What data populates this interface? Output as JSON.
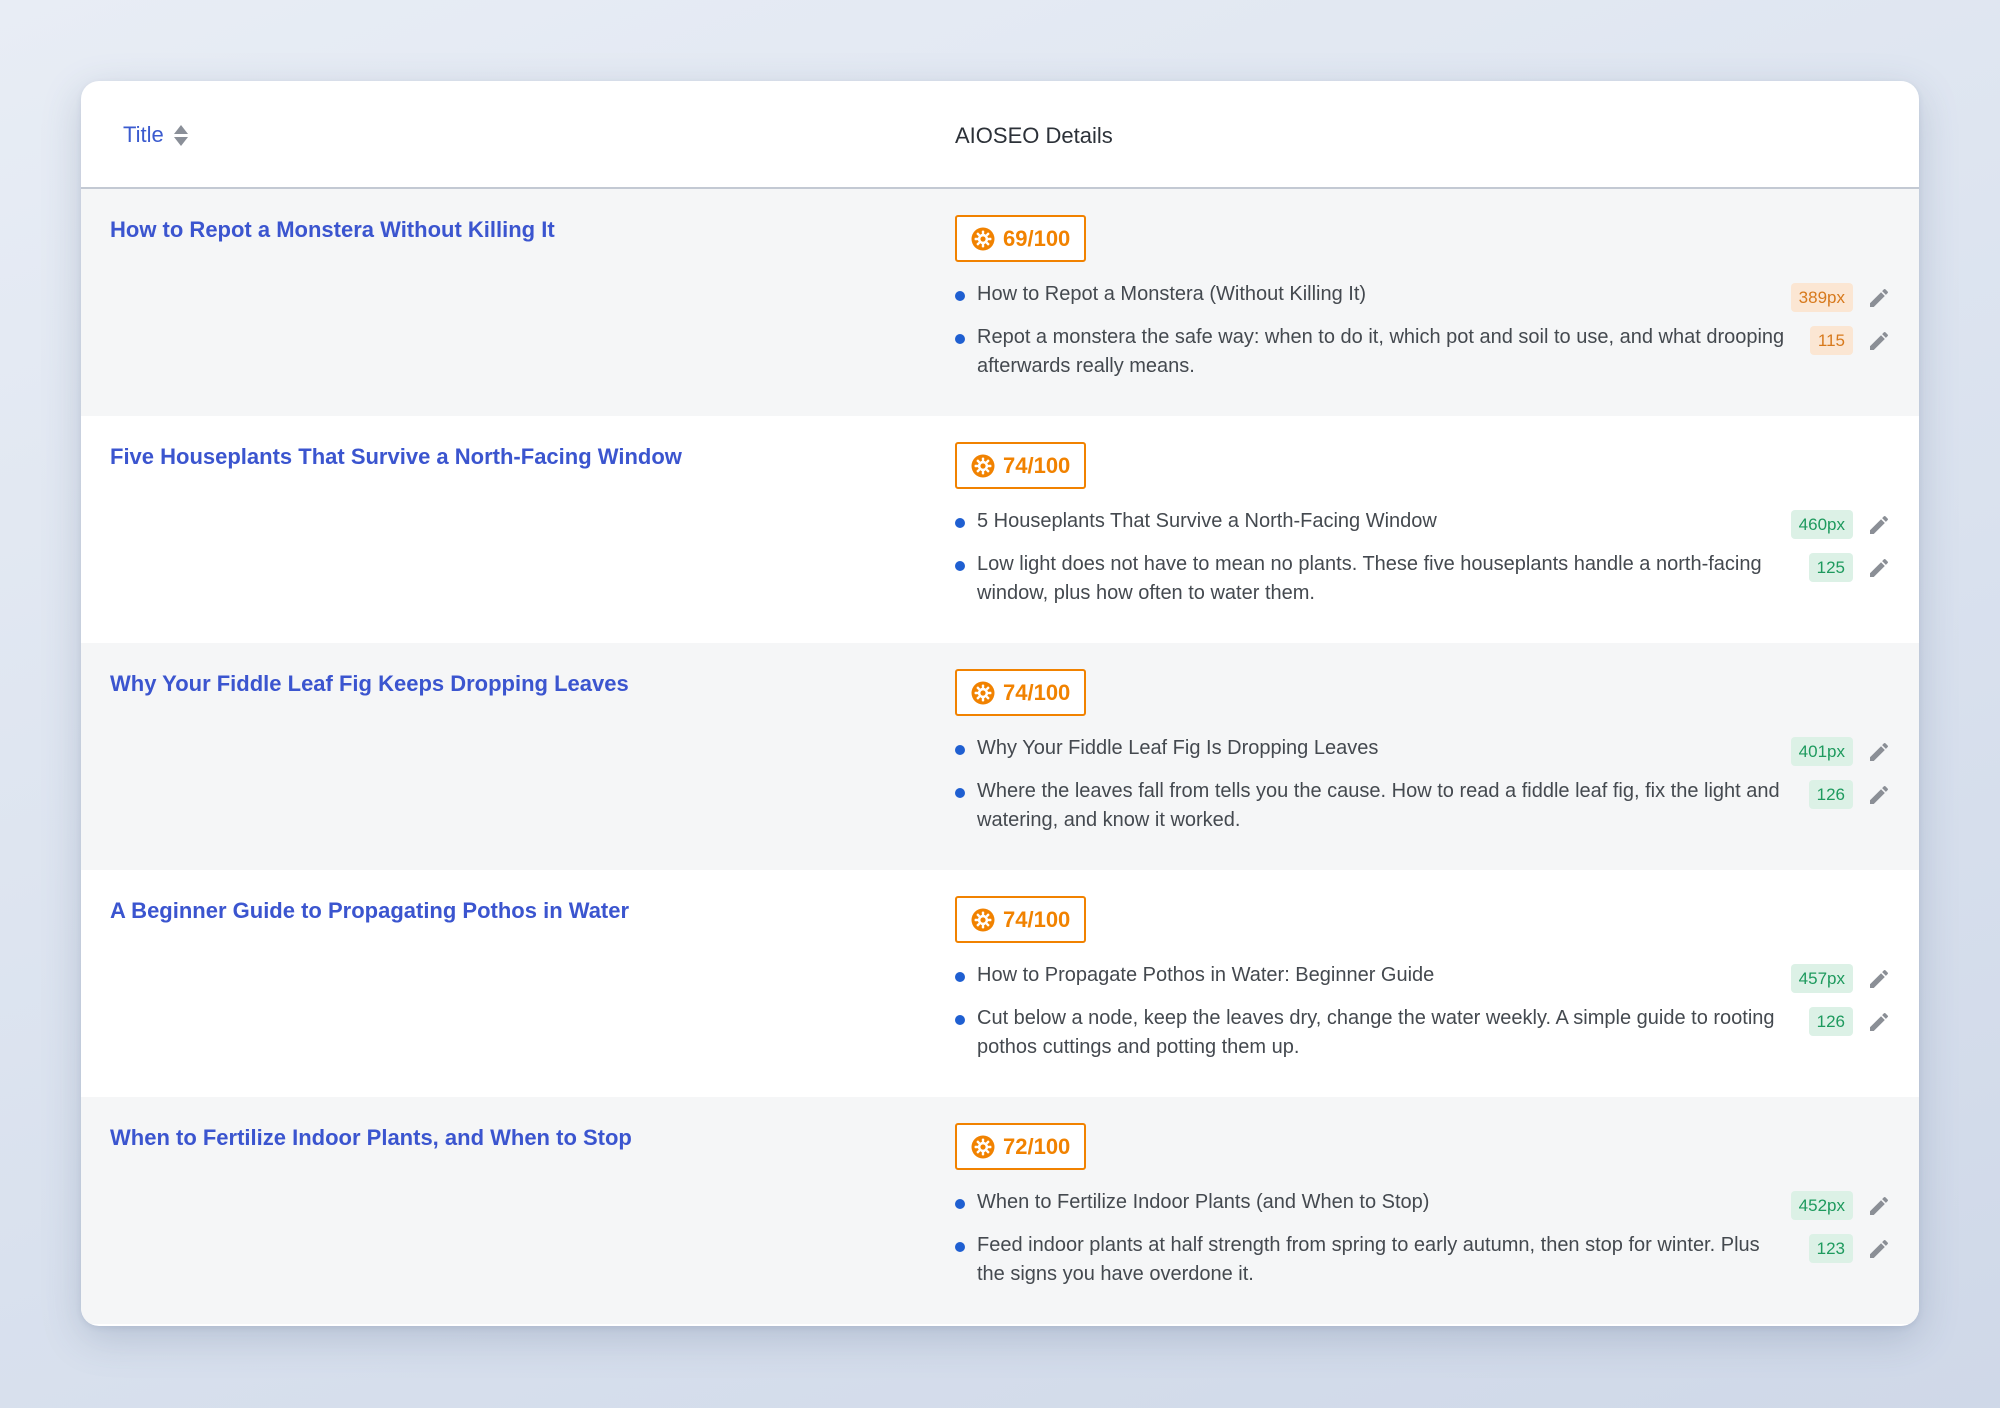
{
  "header": {
    "title_label": "Title",
    "details_label": "AIOSEO Details"
  },
  "colors": {
    "link": "#3b55cf",
    "score": "#f18200",
    "bullet": "#1f5fd1",
    "badge_warn_bg": "#fbe6d3",
    "badge_warn_text": "#d7791c",
    "badge_good_bg": "#dcf1e6",
    "badge_good_text": "#1e9a5e"
  },
  "icons": {
    "sort": "sort-icon",
    "score": "gear-icon",
    "edit": "pencil-icon"
  },
  "rows": [
    {
      "title": "How to Repot a Monstera Without Killing It",
      "score": "69/100",
      "seo_title": "How to Repot a Monstera (Without Killing It)",
      "seo_title_badge": "389px",
      "seo_title_status": "warn",
      "description": "Repot a monstera the safe way: when to do it, which pot and soil to use, and what drooping afterwards really means.",
      "description_badge": "115",
      "description_status": "warn"
    },
    {
      "title": "Five Houseplants That Survive a North-Facing Window",
      "score": "74/100",
      "seo_title": "5 Houseplants That Survive a North-Facing Window",
      "seo_title_badge": "460px",
      "seo_title_status": "good",
      "description": "Low light does not have to mean no plants. These five houseplants handle a north-facing window, plus how often to water them.",
      "description_badge": "125",
      "description_status": "good"
    },
    {
      "title": "Why Your Fiddle Leaf Fig Keeps Dropping Leaves",
      "score": "74/100",
      "seo_title": "Why Your Fiddle Leaf Fig Is Dropping Leaves",
      "seo_title_badge": "401px",
      "seo_title_status": "good",
      "description": "Where the leaves fall from tells you the cause. How to read a fiddle leaf fig, fix the light and watering, and know it worked.",
      "description_badge": "126",
      "description_status": "good"
    },
    {
      "title": "A Beginner Guide to Propagating Pothos in Water",
      "score": "74/100",
      "seo_title": "How to Propagate Pothos in Water: Beginner Guide",
      "seo_title_badge": "457px",
      "seo_title_status": "good",
      "description": "Cut below a node, keep the leaves dry, change the water weekly. A simple guide to rooting pothos cuttings and potting them up.",
      "description_badge": "126",
      "description_status": "good"
    },
    {
      "title": "When to Fertilize Indoor Plants, and When to Stop",
      "score": "72/100",
      "seo_title": "When to Fertilize Indoor Plants (and When to Stop)",
      "seo_title_badge": "452px",
      "seo_title_status": "good",
      "description": "Feed indoor plants at half strength from spring to early autumn, then stop for winter. Plus the signs you have overdone it.",
      "description_badge": "123",
      "description_status": "good"
    }
  ]
}
